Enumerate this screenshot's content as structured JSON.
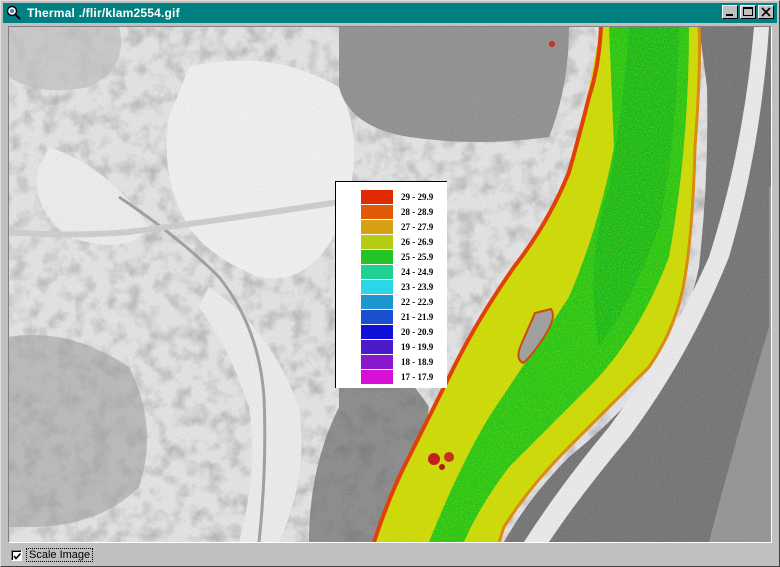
{
  "window": {
    "title": "Thermal ./flir/klam2554.gif",
    "icon": "map-search-icon",
    "buttons": [
      "minimize-icon",
      "maximize-icon",
      "close-icon"
    ]
  },
  "legend": {
    "items": [
      {
        "label": "29 - 29.9",
        "color": "#e02a00"
      },
      {
        "label": "28 - 28.9",
        "color": "#e25a08"
      },
      {
        "label": "27 - 27.9",
        "color": "#d6a014"
      },
      {
        "label": "26 - 26.9",
        "color": "#b6cc14"
      },
      {
        "label": "25 - 25.9",
        "color": "#22c428"
      },
      {
        "label": "24 - 24.9",
        "color": "#20d092"
      },
      {
        "label": "23 - 23.9",
        "color": "#2ad6e8"
      },
      {
        "label": "22 - 22.9",
        "color": "#1e96d2"
      },
      {
        "label": "21 - 21.9",
        "color": "#1a50d0"
      },
      {
        "label": "20 - 20.9",
        "color": "#1010d8"
      },
      {
        "label": "19 - 19.9",
        "color": "#4c1ac8"
      },
      {
        "label": "18 - 18.9",
        "color": "#8a18cc"
      },
      {
        "label": "17 - 17.9",
        "color": "#d810d6"
      }
    ]
  },
  "status": {
    "scale_image_label": "Scale Image",
    "scale_image_checked": true
  }
}
